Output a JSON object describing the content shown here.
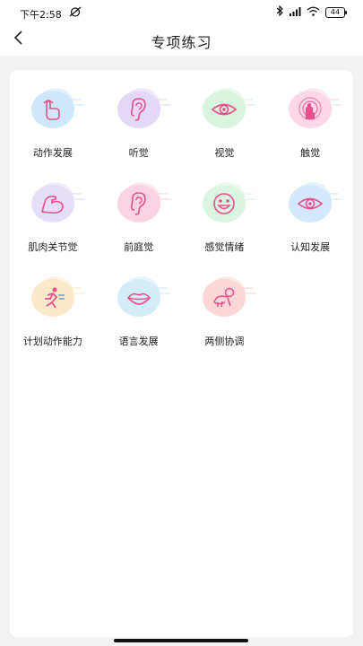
{
  "statusbar": {
    "time": "下午2:58",
    "battery": "44"
  },
  "header": {
    "title": "专项练习"
  },
  "items": [
    {
      "label": "动作发展",
      "icon": "pointing-hand-icon",
      "bg": "#cfe7fb"
    },
    {
      "label": "听觉",
      "icon": "ear-icon",
      "bg": "#e3d9f7"
    },
    {
      "label": "视觉",
      "icon": "eye-icon",
      "bg": "#d9f4df"
    },
    {
      "label": "触觉",
      "icon": "touch-hand-icon",
      "bg": "#fbd7e8"
    },
    {
      "label": "肌肉关节觉",
      "icon": "flexed-arm-icon",
      "bg": "#e6ddf8"
    },
    {
      "label": "前庭觉",
      "icon": "ear-icon",
      "bg": "#fbd3e3"
    },
    {
      "label": "感觉情绪",
      "icon": "smiley-face-icon",
      "bg": "#dcf4e2"
    },
    {
      "label": "认知发展",
      "icon": "eye-icon",
      "bg": "#d4e8fb"
    },
    {
      "label": "计划动作能力",
      "icon": "running-person-icon",
      "bg": "#fbe9c9"
    },
    {
      "label": "语言发展",
      "icon": "lips-icon",
      "bg": "#d4ecf7"
    },
    {
      "label": "两侧协调",
      "icon": "crawling-baby-icon",
      "bg": "#fbd7d7"
    }
  ],
  "colors": {
    "icon_stroke": "#e94f8b",
    "accent": "#e94f8b"
  }
}
